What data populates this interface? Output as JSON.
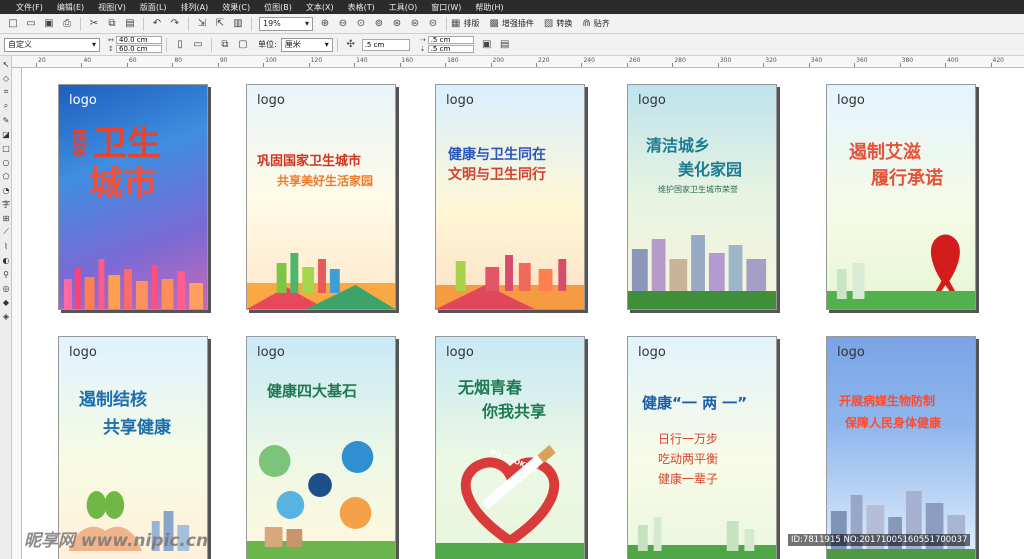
{
  "menu": [
    "文件(F)",
    "编辑(E)",
    "视图(V)",
    "版面(L)",
    "排列(A)",
    "效果(C)",
    "位图(B)",
    "文本(X)",
    "表格(T)",
    "工具(O)",
    "窗口(W)",
    "帮助(H)"
  ],
  "toolbar": {
    "zoom": "19%",
    "btn_arrange": "排版",
    "btn_plugin": "增强插件",
    "btn_convert": "转换",
    "btn_paste": "贴齐"
  },
  "propbar": {
    "preset": "自定义",
    "width": "40.0 cm",
    "height": "60.0 cm",
    "unit_label": "单位:",
    "unit": "厘米",
    "nudge": ".5 cm",
    "dup_x": ".5 cm",
    "dup_y": ".5 cm"
  },
  "ruler": [
    "20",
    "40",
    "60",
    "80",
    "90",
    "100",
    "120",
    "140",
    "160",
    "180",
    "200",
    "220",
    "240",
    "260",
    "280",
    "300",
    "320",
    "340",
    "360",
    "380",
    "400",
    "420"
  ],
  "posters": [
    {
      "logo": "logo",
      "lines": [
        "国家",
        "卫生",
        "城市"
      ]
    },
    {
      "logo": "logo",
      "lines": [
        "巩固国家卫生城市",
        "共享美好生活家园"
      ]
    },
    {
      "logo": "logo",
      "lines": [
        "健康与卫生同在",
        "文明与卫生同行"
      ]
    },
    {
      "logo": "logo",
      "lines": [
        "清洁城乡",
        "美化家园",
        "维护国家卫生城市荣誉"
      ]
    },
    {
      "logo": "logo",
      "lines": [
        "遏制艾滋",
        "履行承诺"
      ]
    },
    {
      "logo": "logo",
      "lines": [
        "遏制结核",
        "共享健康"
      ]
    },
    {
      "logo": "logo",
      "lines": [
        "健康四大基石"
      ]
    },
    {
      "logo": "logo",
      "lines": [
        "无烟青春",
        "你我共享",
        "NO SMOKING"
      ]
    },
    {
      "logo": "logo",
      "lines": [
        "健康“一 两 一”",
        "日行一万步",
        "吃动两平衡",
        "健康一辈子"
      ]
    },
    {
      "logo": "logo",
      "lines": [
        "开展病媒生物防制",
        "保障人民身体健康"
      ]
    }
  ],
  "watermark": "昵享网 www.nipic.cn",
  "image_id": "ID:7811915 NO:20171005160551700037"
}
